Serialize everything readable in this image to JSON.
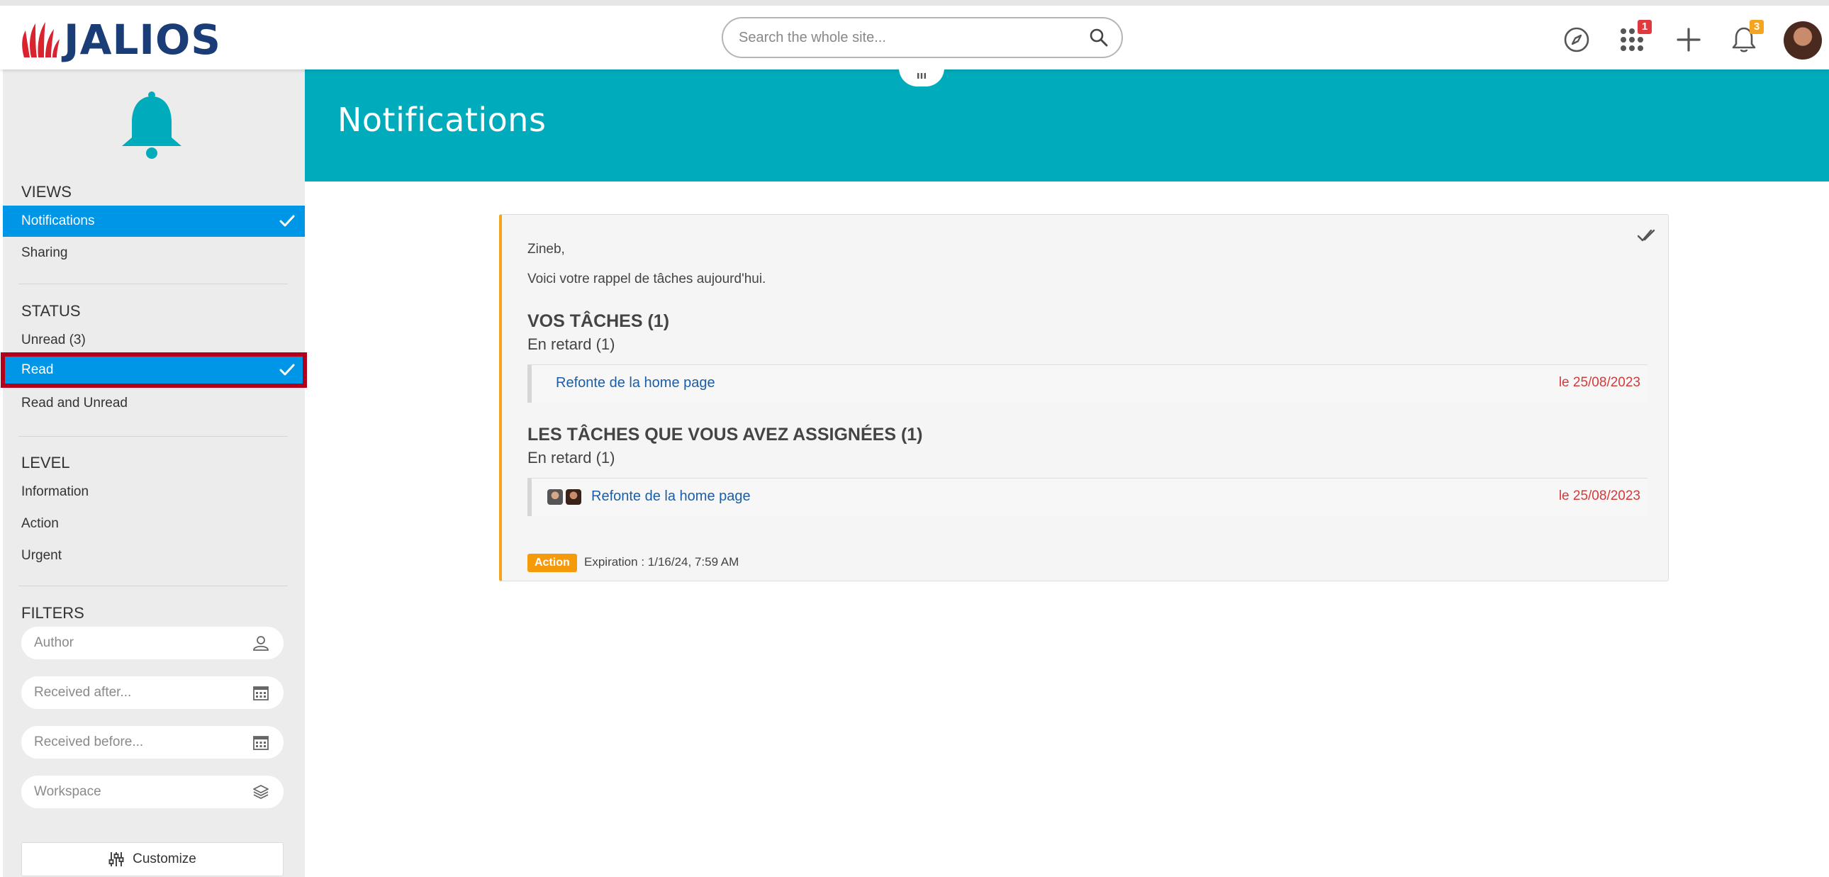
{
  "header": {
    "logo_text": "JALIOS",
    "search_placeholder": "Search the whole site...",
    "apps_badge": "1",
    "notifications_badge": "3",
    "colors": {
      "brand_red": "#d9232e",
      "brand_blue": "#1a3d78",
      "badge_red": "#e0393e",
      "badge_orange": "#f5a41f"
    }
  },
  "sidebar": {
    "views_title": "VIEWS",
    "views": [
      {
        "label": "Notifications",
        "active": true
      },
      {
        "label": "Sharing",
        "active": false
      }
    ],
    "status_title": "STATUS",
    "status": [
      {
        "label": "Unread (3)",
        "active": false
      },
      {
        "label": "Read",
        "active": true
      },
      {
        "label": "Read and Unread",
        "active": false
      }
    ],
    "level_title": "LEVEL",
    "levels": [
      {
        "label": "Information"
      },
      {
        "label": "Action"
      },
      {
        "label": "Urgent"
      }
    ],
    "filters_title": "FILTERS",
    "filters": {
      "author_placeholder": "Author",
      "received_after_placeholder": "Received after...",
      "received_before_placeholder": "Received before...",
      "workspace_placeholder": "Workspace"
    },
    "customize_label": "Customize",
    "colors": {
      "active_bg": "#0096e8",
      "bell": "#00abbb"
    }
  },
  "main": {
    "title": "Notifications",
    "banner_color": "#00abbb",
    "notification": {
      "greeting": "Zineb,",
      "intro": "Voici votre rappel de tâches aujourd'hui.",
      "section1_title": "VOS TÂCHES (1)",
      "section1_sub": "En retard (1)",
      "task1_name": "Refonte de la home page",
      "task1_date": "le 25/08/2023",
      "section2_title": "LES TÂCHES QUE VOUS AVEZ ASSIGNÉES (1)",
      "section2_sub": "En retard (1)",
      "task2_name": "Refonte de la home page",
      "task2_date": "le 25/08/2023",
      "level_tag": "Action",
      "expiration": "Expiration : 1/16/24, 7:59 AM"
    }
  }
}
